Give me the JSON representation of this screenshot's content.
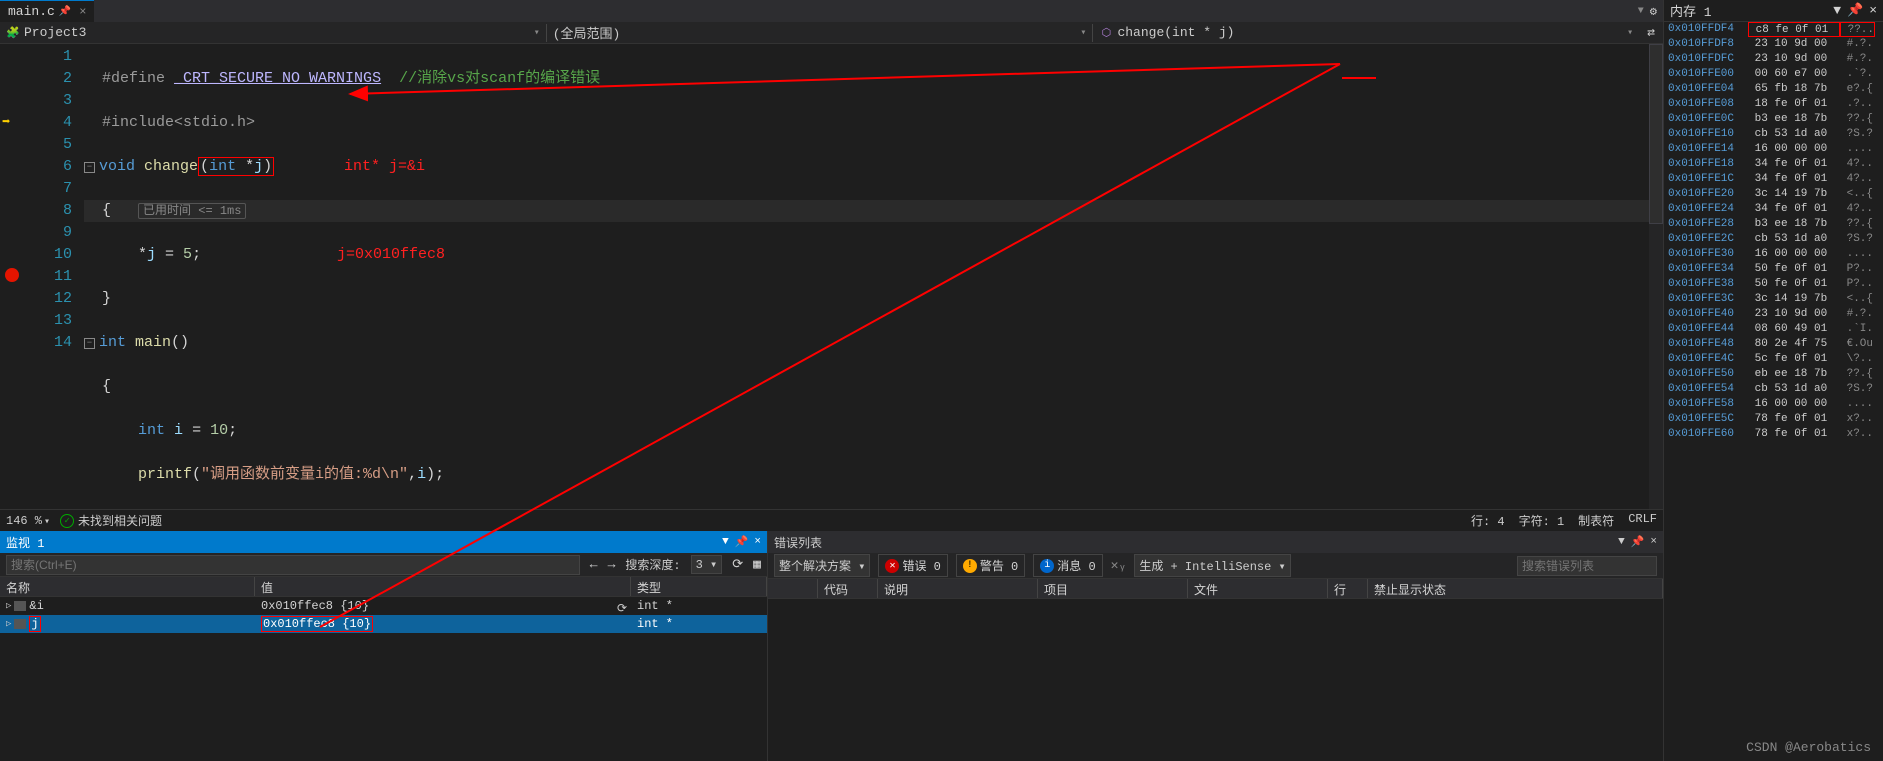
{
  "tab": {
    "filename": "main.c",
    "pin": "📌",
    "close": "×"
  },
  "breadcrumb": {
    "project": "Project3",
    "scope": "(全局范围)",
    "function": "change(int * j)"
  },
  "annotations": {
    "param": "int* j=&i",
    "jval": "j=0x010ffec8"
  },
  "code": {
    "hint": "已用时间 <= 1ms",
    "lines": [
      "1",
      "2",
      "3",
      "4",
      "5",
      "6",
      "7",
      "8",
      "9",
      "10",
      "11",
      "12",
      "13",
      "14"
    ]
  },
  "footer": {
    "zoom": "146 %",
    "issues": "未找到相关问题",
    "pos": "行: 4",
    "col": "字符: 1",
    "tab": "制表符",
    "eol": "CRLF"
  },
  "watch": {
    "title": "监视 1",
    "searchPlaceholder": "搜索(Ctrl+E)",
    "depthLabel": "搜索深度:",
    "depthVal": "3",
    "cols": {
      "name": "名称",
      "value": "值",
      "type": "类型"
    },
    "rows": [
      {
        "name": "&i",
        "value": "0x010ffec8 {10}",
        "type": "int *",
        "selected": false
      },
      {
        "name": "j",
        "value": "0x010ffec8 {10}",
        "type": "int *",
        "selected": true
      }
    ]
  },
  "errors": {
    "title": "错误列表",
    "scope": "整个解决方案",
    "errLabel": "错误 0",
    "warnLabel": "警告 0",
    "msgLabel": "消息 0",
    "build": "生成 + IntelliSense",
    "filterPlaceholder": "搜索错误列表",
    "cols": {
      "code": "代码",
      "desc": "说明",
      "proj": "项目",
      "file": "文件",
      "line": "行",
      "state": "禁止显示状态"
    }
  },
  "memory": {
    "title": "内存 1",
    "rows": [
      {
        "addr": "0x010FFDF4",
        "hex": "c8 fe 0f 01",
        "asc": "??.."
      },
      {
        "addr": "0x010FFDF8",
        "hex": "23 10 9d 00",
        "asc": "#.?."
      },
      {
        "addr": "0x010FFDFC",
        "hex": "23 10 9d 00",
        "asc": "#.?."
      },
      {
        "addr": "0x010FFE00",
        "hex": "00 60 e7 00",
        "asc": ".`?."
      },
      {
        "addr": "0x010FFE04",
        "hex": "65 fb 18 7b",
        "asc": "e?.{"
      },
      {
        "addr": "0x010FFE08",
        "hex": "18 fe 0f 01",
        "asc": ".?.."
      },
      {
        "addr": "0x010FFE0C",
        "hex": "b3 ee 18 7b",
        "asc": "??.{"
      },
      {
        "addr": "0x010FFE10",
        "hex": "cb 53 1d a0",
        "asc": "?S.?"
      },
      {
        "addr": "0x010FFE14",
        "hex": "16 00 00 00",
        "asc": "...."
      },
      {
        "addr": "0x010FFE18",
        "hex": "34 fe 0f 01",
        "asc": "4?.."
      },
      {
        "addr": "0x010FFE1C",
        "hex": "34 fe 0f 01",
        "asc": "4?.."
      },
      {
        "addr": "0x010FFE20",
        "hex": "3c 14 19 7b",
        "asc": "<..{"
      },
      {
        "addr": "0x010FFE24",
        "hex": "34 fe 0f 01",
        "asc": "4?.."
      },
      {
        "addr": "0x010FFE28",
        "hex": "b3 ee 18 7b",
        "asc": "??.{"
      },
      {
        "addr": "0x010FFE2C",
        "hex": "cb 53 1d a0",
        "asc": "?S.?"
      },
      {
        "addr": "0x010FFE30",
        "hex": "16 00 00 00",
        "asc": "...."
      },
      {
        "addr": "0x010FFE34",
        "hex": "50 fe 0f 01",
        "asc": "P?.."
      },
      {
        "addr": "0x010FFE38",
        "hex": "50 fe 0f 01",
        "asc": "P?.."
      },
      {
        "addr": "0x010FFE3C",
        "hex": "3c 14 19 7b",
        "asc": "<..{"
      },
      {
        "addr": "0x010FFE40",
        "hex": "23 10 9d 00",
        "asc": "#.?."
      },
      {
        "addr": "0x010FFE44",
        "hex": "08 60 49 01",
        "asc": ".`I."
      },
      {
        "addr": "0x010FFE48",
        "hex": "80 2e 4f 75",
        "asc": "€.Ou"
      },
      {
        "addr": "0x010FFE4C",
        "hex": "5c fe 0f 01",
        "asc": "\\?.."
      },
      {
        "addr": "0x010FFE50",
        "hex": "eb ee 18 7b",
        "asc": "??.{"
      },
      {
        "addr": "0x010FFE54",
        "hex": "cb 53 1d a0",
        "asc": "?S.?"
      },
      {
        "addr": "0x010FFE58",
        "hex": "16 00 00 00",
        "asc": "...."
      },
      {
        "addr": "0x010FFE5C",
        "hex": "78 fe 0f 01",
        "asc": "x?.."
      },
      {
        "addr": "0x010FFE60",
        "hex": "78 fe 0f 01",
        "asc": "x?.."
      }
    ]
  },
  "watermark": "CSDN @Aerobatics"
}
